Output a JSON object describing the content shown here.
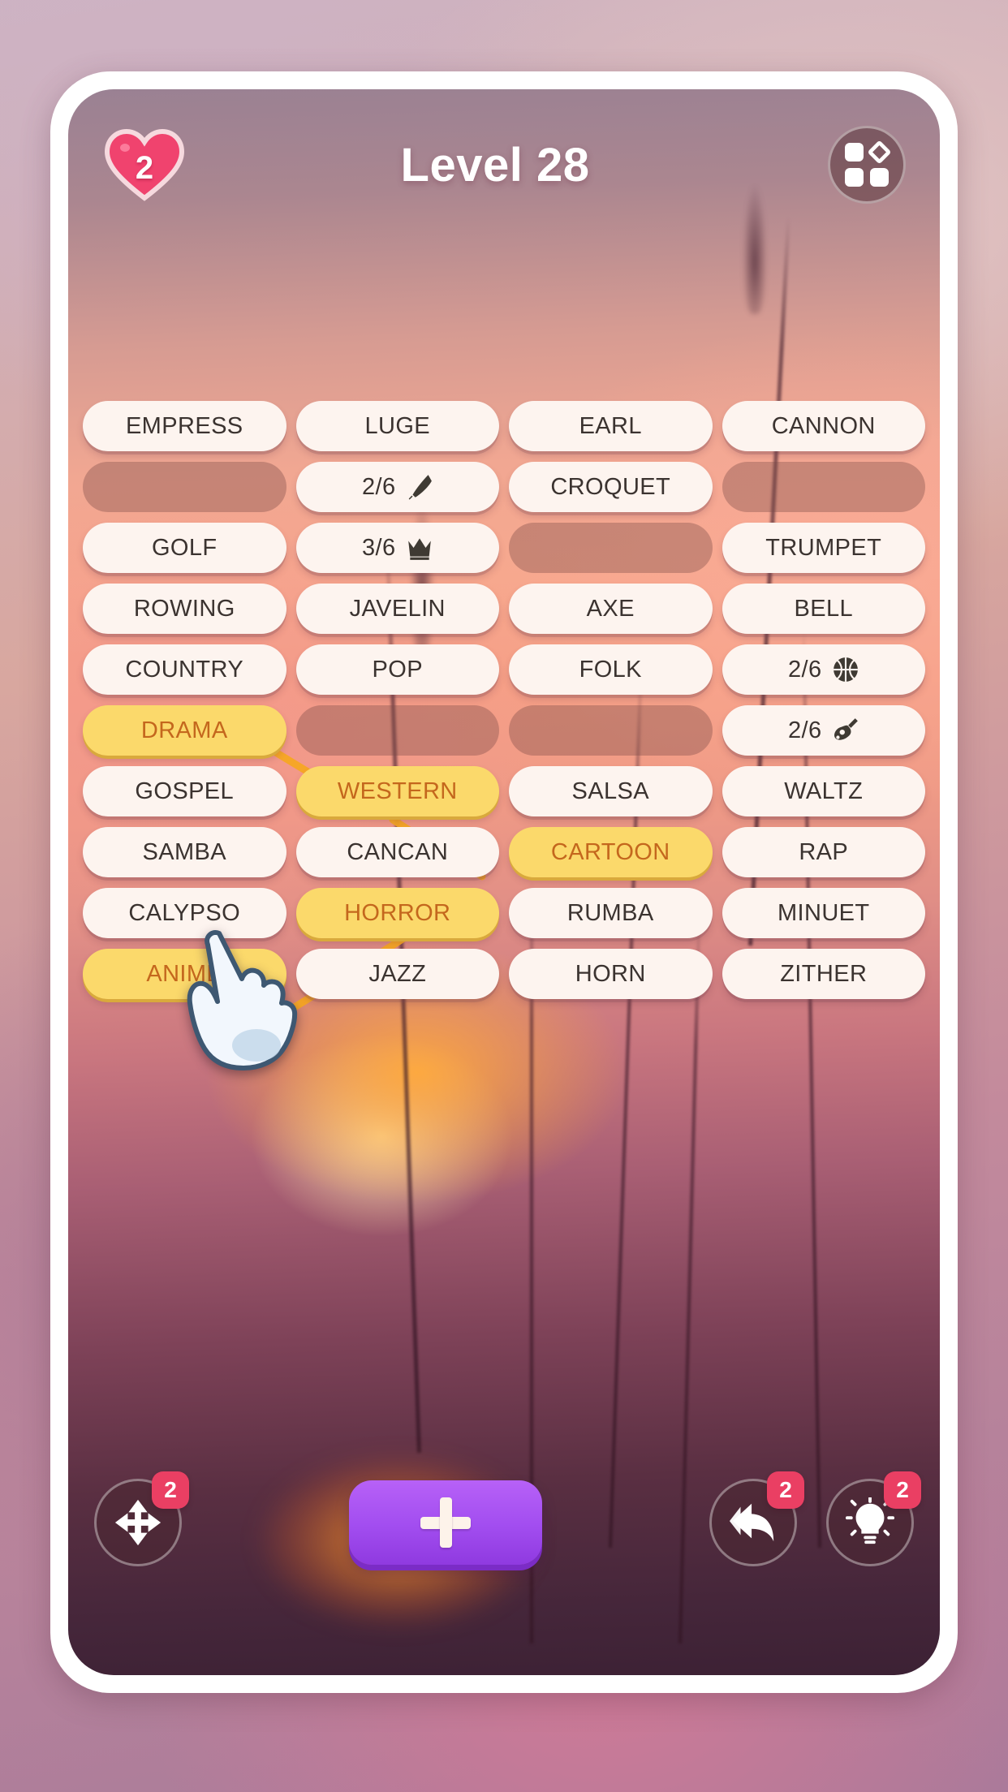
{
  "header": {
    "lives": "2",
    "lives_icon": "heart-icon",
    "title": "Level 28",
    "menu_icon": "grid-menu-icon"
  },
  "grid": {
    "columns": 4,
    "tiles": [
      {
        "label": "EMPRESS",
        "state": "normal"
      },
      {
        "label": "LUGE",
        "state": "normal"
      },
      {
        "label": "EARL",
        "state": "normal"
      },
      {
        "label": "CANNON",
        "state": "normal"
      },
      {
        "label": "",
        "state": "empty"
      },
      {
        "label": "2/6",
        "state": "progress",
        "icon": "knife-icon"
      },
      {
        "label": "CROQUET",
        "state": "normal"
      },
      {
        "label": "",
        "state": "empty"
      },
      {
        "label": "GOLF",
        "state": "normal"
      },
      {
        "label": "3/6",
        "state": "progress",
        "icon": "crown-icon"
      },
      {
        "label": "",
        "state": "empty"
      },
      {
        "label": "TRUMPET",
        "state": "normal"
      },
      {
        "label": "ROWING",
        "state": "normal"
      },
      {
        "label": "JAVELIN",
        "state": "normal"
      },
      {
        "label": "AXE",
        "state": "normal"
      },
      {
        "label": "BELL",
        "state": "normal"
      },
      {
        "label": "COUNTRY",
        "state": "normal"
      },
      {
        "label": "POP",
        "state": "normal"
      },
      {
        "label": "FOLK",
        "state": "normal"
      },
      {
        "label": "2/6",
        "state": "progress",
        "icon": "basketball-icon"
      },
      {
        "label": "DRAMA",
        "state": "selected"
      },
      {
        "label": "",
        "state": "empty"
      },
      {
        "label": "",
        "state": "empty"
      },
      {
        "label": "2/6",
        "state": "progress",
        "icon": "guitar-icon"
      },
      {
        "label": "GOSPEL",
        "state": "normal"
      },
      {
        "label": "WESTERN",
        "state": "selected"
      },
      {
        "label": "SALSA",
        "state": "normal"
      },
      {
        "label": "WALTZ",
        "state": "normal"
      },
      {
        "label": "SAMBA",
        "state": "normal"
      },
      {
        "label": "CANCAN",
        "state": "normal"
      },
      {
        "label": "CARTOON",
        "state": "selected"
      },
      {
        "label": "RAP",
        "state": "normal"
      },
      {
        "label": "CALYPSO",
        "state": "normal"
      },
      {
        "label": "HORROR",
        "state": "selected"
      },
      {
        "label": "RUMBA",
        "state": "normal"
      },
      {
        "label": "MINUET",
        "state": "normal"
      },
      {
        "label": "ANIME",
        "state": "selected"
      },
      {
        "label": "JAZZ",
        "state": "normal"
      },
      {
        "label": "HORN",
        "state": "normal"
      },
      {
        "label": "ZITHER",
        "state": "normal"
      }
    ]
  },
  "toolbar": {
    "shuffle": {
      "icon": "move-arrows-icon",
      "badge": "2"
    },
    "add": {
      "icon": "plus-icon"
    },
    "undo": {
      "icon": "undo-arrow-icon",
      "badge": "2"
    },
    "hint": {
      "icon": "lightbulb-icon",
      "badge": "2"
    }
  },
  "cursor": {
    "icon": "pointing-hand-icon"
  },
  "colors": {
    "tile_bg": "#fdf4ef",
    "tile_text": "#3b3330",
    "tile_selected_bg": "#fbd96b",
    "tile_selected_text": "#c4671d",
    "tile_empty_bg": "#78484666",
    "link_line": "#f5a623",
    "badge": "#ea3f63",
    "heart": "#f0436e",
    "add_button": "#a34ef0",
    "frame": "#ffffff"
  }
}
